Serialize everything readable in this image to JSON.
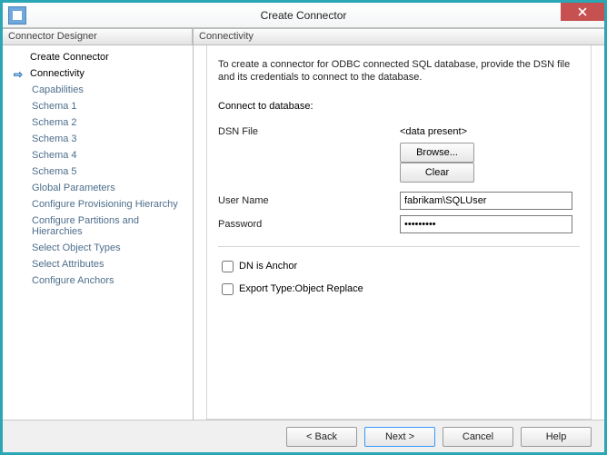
{
  "window": {
    "title": "Create Connector"
  },
  "sidebar": {
    "header": "Connector Designer",
    "items": [
      {
        "label": "Create Connector",
        "active": false,
        "level": 0
      },
      {
        "label": "Connectivity",
        "active": true,
        "level": 0
      },
      {
        "label": "Capabilities",
        "active": false,
        "level": 1
      },
      {
        "label": "Schema 1",
        "active": false,
        "level": 1
      },
      {
        "label": "Schema 2",
        "active": false,
        "level": 1
      },
      {
        "label": "Schema 3",
        "active": false,
        "level": 1
      },
      {
        "label": "Schema 4",
        "active": false,
        "level": 1
      },
      {
        "label": "Schema 5",
        "active": false,
        "level": 1
      },
      {
        "label": "Global Parameters",
        "active": false,
        "level": 1
      },
      {
        "label": "Configure Provisioning Hierarchy",
        "active": false,
        "level": 1
      },
      {
        "label": "Configure Partitions and Hierarchies",
        "active": false,
        "level": 1
      },
      {
        "label": "Select Object Types",
        "active": false,
        "level": 1
      },
      {
        "label": "Select Attributes",
        "active": false,
        "level": 1
      },
      {
        "label": "Configure Anchors",
        "active": false,
        "level": 1
      }
    ]
  },
  "main": {
    "header": "Connectivity",
    "description": "To create a connector for ODBC connected SQL database, provide the DSN file and its credentials to connect to the database.",
    "section_label": "Connect to database:",
    "dsn": {
      "label": "DSN File",
      "value": "<data present>",
      "browse": "Browse...",
      "clear": "Clear"
    },
    "user": {
      "label": "User Name",
      "value": "fabrikam\\SQLUser"
    },
    "password": {
      "label": "Password",
      "value": "•••••••••"
    },
    "dn_anchor": {
      "label": "DN is Anchor",
      "checked": false
    },
    "export_type": {
      "label": "Export Type:Object Replace",
      "checked": false
    }
  },
  "footer": {
    "back": "<  Back",
    "next": "Next  >",
    "cancel": "Cancel",
    "help": "Help"
  }
}
